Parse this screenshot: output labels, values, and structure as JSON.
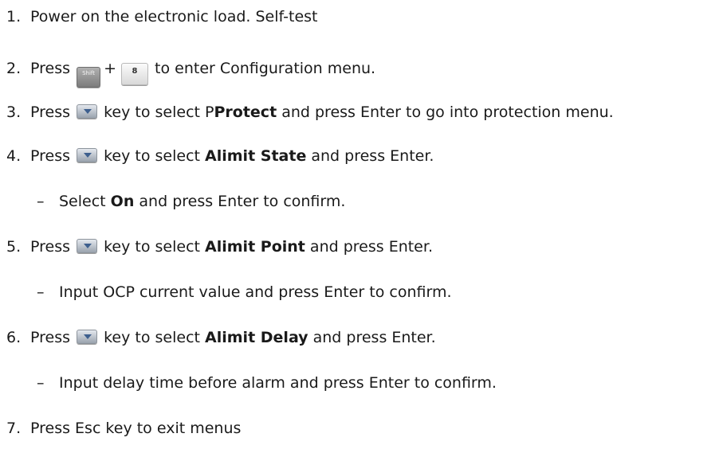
{
  "steps": [
    {
      "num": "1.",
      "text": "Power on the electronic load. Self-test"
    },
    {
      "num": "2.",
      "pre": "Press",
      "plus": "+",
      "post": "to enter Configuration menu.",
      "keys": {
        "shift": "Shift",
        "eight": "8"
      }
    },
    {
      "num": "3.",
      "pre": "Press",
      "mid": "key to select P",
      "bold": "Protect",
      "post": "and press Enter to go into protection menu."
    },
    {
      "num": "4.",
      "pre": "Press",
      "mid": "key to select",
      "bold": "Alimit State",
      "post": "and press Enter."
    },
    {
      "num": "5.",
      "pre": "Press",
      "mid": "key to select",
      "bold": "Alimit Point",
      "post": "and press Enter."
    },
    {
      "num": "6.",
      "pre": "Press",
      "mid": "key to select",
      "bold": "Alimit Delay",
      "post": "and press Enter."
    },
    {
      "num": "7.",
      "text": "Press Esc key to exit menus"
    }
  ],
  "substeps": [
    {
      "dash": "–",
      "pre": "Select",
      "bold": "On",
      "post": "and press Enter to confirm."
    },
    {
      "dash": "–",
      "text": "Input OCP current value and press Enter to confirm."
    },
    {
      "dash": "–",
      "text": "Input delay time before alarm and press Enter to confirm."
    }
  ],
  "icons": {
    "down_key": "down-arrow-key-icon"
  },
  "colors": {
    "text": "#1a1a1a",
    "down_key_arrow": "#3d5f8e"
  }
}
